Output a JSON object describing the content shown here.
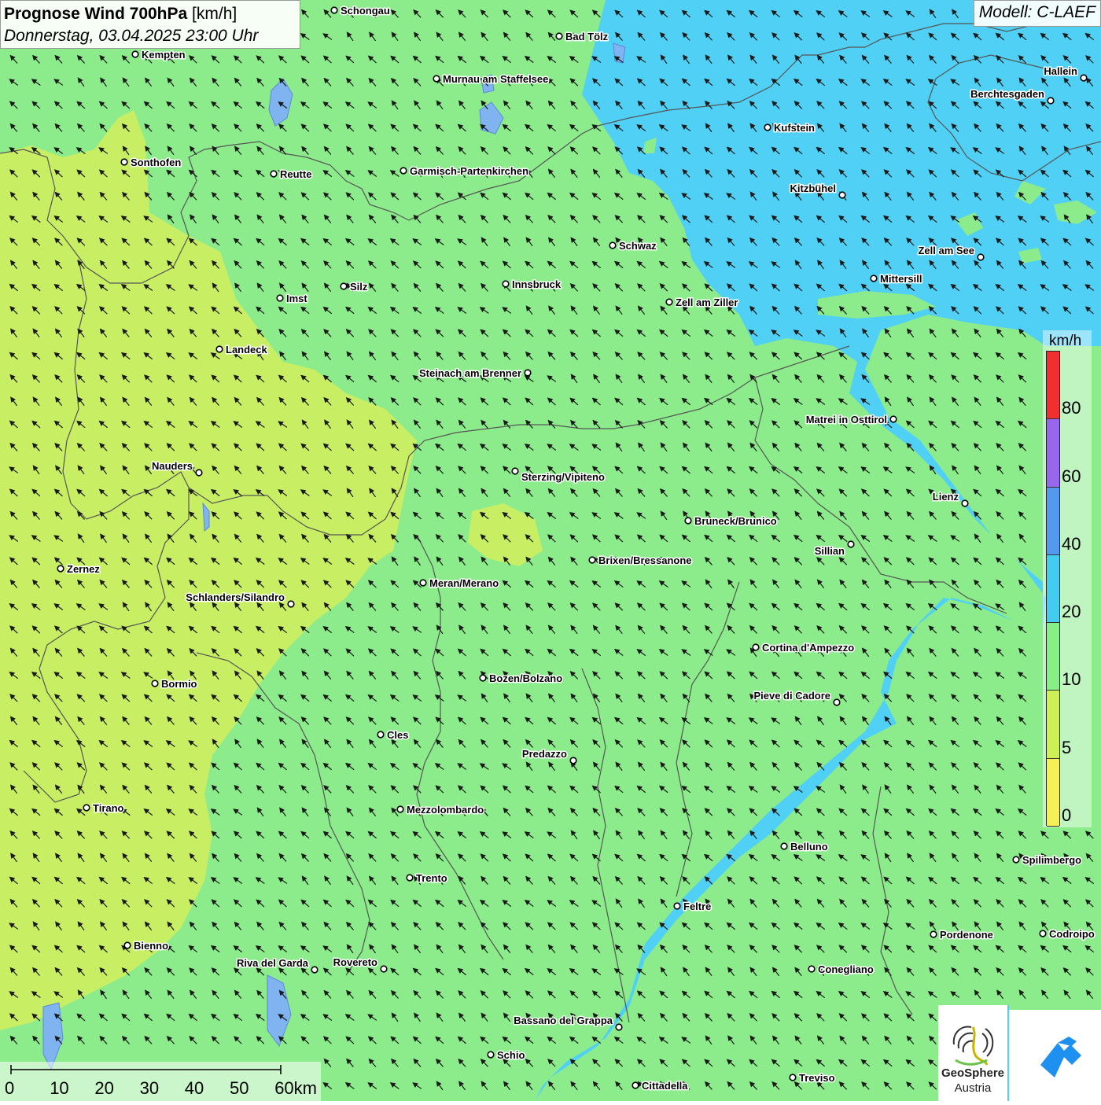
{
  "header": {
    "title_bold": "Prognose Wind 700hPa",
    "title_unit": " [km/h]",
    "subtitle": "Donnerstag, 03.04.2025 23:00 Uhr",
    "model": "Modell: C-LAEF"
  },
  "legend": {
    "unit": "km/h",
    "ticks": [
      "80",
      "60",
      "40",
      "20",
      "10",
      "5",
      "0"
    ],
    "colors": [
      "#f03030",
      "#9966ee",
      "#5599ee",
      "#44ccf0",
      "#88ee88",
      "#ccf055",
      "#f5f055"
    ]
  },
  "scale_bar": {
    "labels": [
      "0",
      "10",
      "20",
      "30",
      "40",
      "50",
      "60km"
    ]
  },
  "cities": [
    {
      "name": "Schongau"
    },
    {
      "name": "Bad Tölz"
    },
    {
      "name": "Kempten"
    },
    {
      "name": "Murnau am Staffelsee"
    },
    {
      "name": "Hallein"
    },
    {
      "name": "Berchtesgaden"
    },
    {
      "name": "Kufstein"
    },
    {
      "name": "Sonthofen"
    },
    {
      "name": "Reutte"
    },
    {
      "name": "Garmisch-Partenkirchen"
    },
    {
      "name": "Kitzbühel"
    },
    {
      "name": "Schwaz"
    },
    {
      "name": "Zell am See"
    },
    {
      "name": "Mittersill"
    },
    {
      "name": "Innsbruck"
    },
    {
      "name": "Silz"
    },
    {
      "name": "Imst"
    },
    {
      "name": "Zell am Ziller"
    },
    {
      "name": "Landeck"
    },
    {
      "name": "Steinach am Brenner"
    },
    {
      "name": "Matrei in Osttirol"
    },
    {
      "name": "Nauders"
    },
    {
      "name": "Sterzing/Vipiteno"
    },
    {
      "name": "Lienz"
    },
    {
      "name": "Bruneck/Brunico"
    },
    {
      "name": "Sillian"
    },
    {
      "name": "Brixen/Bressanone"
    },
    {
      "name": "Zernez"
    },
    {
      "name": "Meran/Merano"
    },
    {
      "name": "Schlanders/Silandro"
    },
    {
      "name": "Cortina d'Ampezzo"
    },
    {
      "name": "Bozen/Bolzano"
    },
    {
      "name": "Bormio"
    },
    {
      "name": "Pieve di Cadore"
    },
    {
      "name": "Cles"
    },
    {
      "name": "Predazzo"
    },
    {
      "name": "Tirano"
    },
    {
      "name": "Mezzolombardo"
    },
    {
      "name": "Belluno"
    },
    {
      "name": "Spilimbergo"
    },
    {
      "name": "Trento"
    },
    {
      "name": "Feltre"
    },
    {
      "name": "Pordenone"
    },
    {
      "name": "Codroipo"
    },
    {
      "name": "Bienno"
    },
    {
      "name": "Riva del Garda"
    },
    {
      "name": "Rovereto"
    },
    {
      "name": "Conegliano"
    },
    {
      "name": "Bassano del Grappa"
    },
    {
      "name": "Schio"
    },
    {
      "name": "Treviso"
    },
    {
      "name": "Cittadella"
    }
  ],
  "logos": {
    "geosphere_line1": "GeoSphere",
    "geosphere_line2": "Austria"
  },
  "colors": {
    "yellow_green": "#ccf055",
    "green": "#88ee88",
    "blue": "#44ccf0",
    "border": "#555555"
  }
}
